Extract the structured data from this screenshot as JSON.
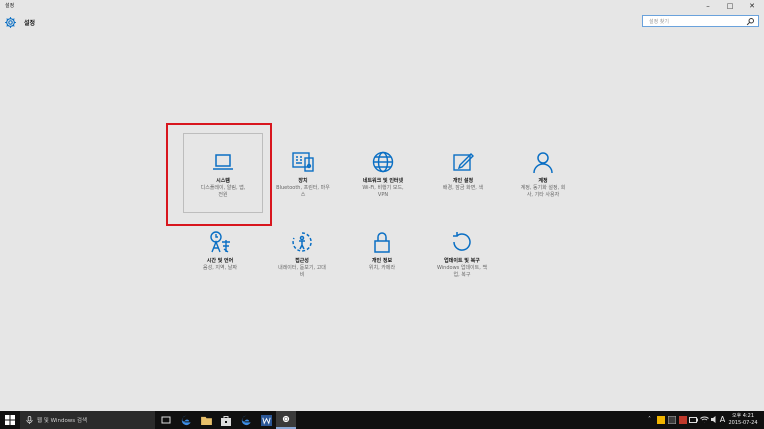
{
  "window": {
    "title": "설정",
    "controls": [
      "–",
      "□",
      "✕"
    ]
  },
  "header": {
    "app_title": "설정",
    "search_placeholder": "설정 찾기"
  },
  "tiles": [
    {
      "id": "system",
      "icon": "laptop-icon",
      "label": "시스템",
      "desc": [
        "디스플레이, 알림, 앱,",
        "전원"
      ]
    },
    {
      "id": "devices",
      "icon": "keyboard-icon",
      "label": "장치",
      "desc": [
        "Bluetooth, 프린터, 마우",
        "스"
      ]
    },
    {
      "id": "network",
      "icon": "globe-icon",
      "label": "네트워크 및 인터넷",
      "desc": [
        "Wi-Fi, 비행기 모드,",
        "VPN"
      ]
    },
    {
      "id": "personalization",
      "icon": "paint-icon",
      "label": "개인 설정",
      "desc": [
        "배경, 잠금 화면, 색",
        ""
      ]
    },
    {
      "id": "accounts",
      "icon": "person-icon",
      "label": "계정",
      "desc": [
        "계정, 동기화 설정, 회",
        "사, 기타 사용자"
      ]
    },
    {
      "id": "time-language",
      "icon": "time-language-icon",
      "label": "시간 및 언어",
      "desc": [
        "음성, 지역, 날짜",
        ""
      ]
    },
    {
      "id": "ease-of-access",
      "icon": "accessibility-icon",
      "label": "접근성",
      "desc": [
        "내레이터, 돋보기, 고대",
        "비"
      ]
    },
    {
      "id": "privacy",
      "icon": "lock-icon",
      "label": "개인 정보",
      "desc": [
        "위치, 카메라",
        ""
      ]
    },
    {
      "id": "update-security",
      "icon": "refresh-icon",
      "label": "업데이트 및 복구",
      "desc": [
        "Windows 업데이트, 백",
        "업, 복구"
      ]
    }
  ],
  "taskbar": {
    "search_placeholder": "웹 및 Windows 검색",
    "clock_time": "오후 4:21",
    "clock_date": "2015-07-24",
    "ime": "A"
  },
  "colors": {
    "accent": "#0a6fc4",
    "highlight": "#d8161e",
    "taskbar": "#101010",
    "background": "#e6e6e6"
  }
}
